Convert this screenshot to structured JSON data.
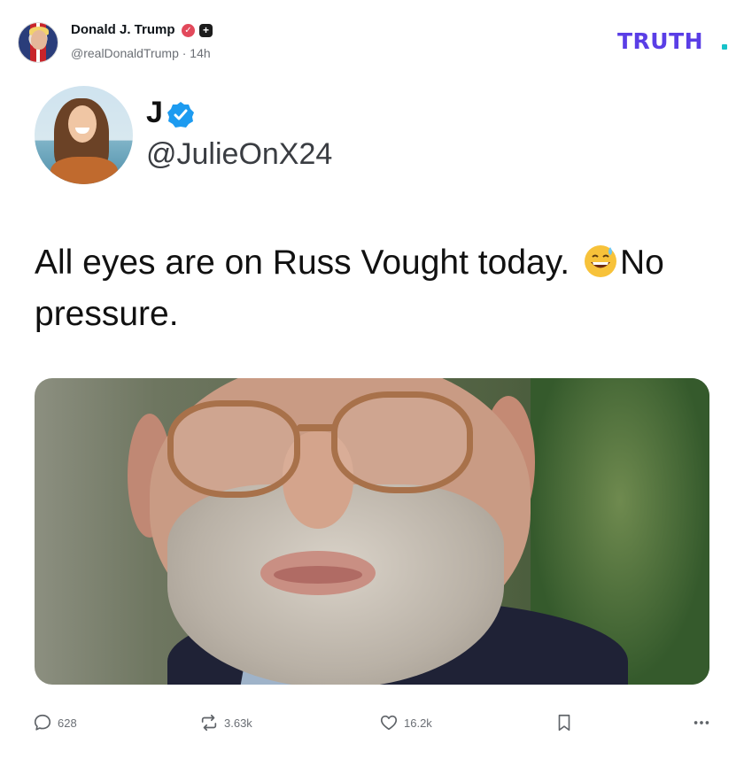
{
  "post": {
    "author_name": "Donald J. Trump",
    "author_handle_time": "@realDonaldTrump · 14h"
  },
  "brand": {
    "logo_text": "TRUTH",
    "logo_dot_color": "#17c2c9",
    "logo_color": "#5a3ee6"
  },
  "embed": {
    "name": "J",
    "handle": "@JulieOnX24",
    "text_before_emoji": "All eyes are on Russ Vought today. ",
    "emoji": "grinning-face-with-sweat",
    "text_after_emoji": "No pressure."
  },
  "actions": {
    "replies": "628",
    "retruths": "3.63k",
    "likes": "16.2k"
  },
  "icons": {
    "reply": "reply-icon",
    "retruth": "retruth-icon",
    "like": "heart-icon",
    "bookmark": "bookmark-icon",
    "more": "more-icon",
    "verified": "verified-badge-icon"
  }
}
